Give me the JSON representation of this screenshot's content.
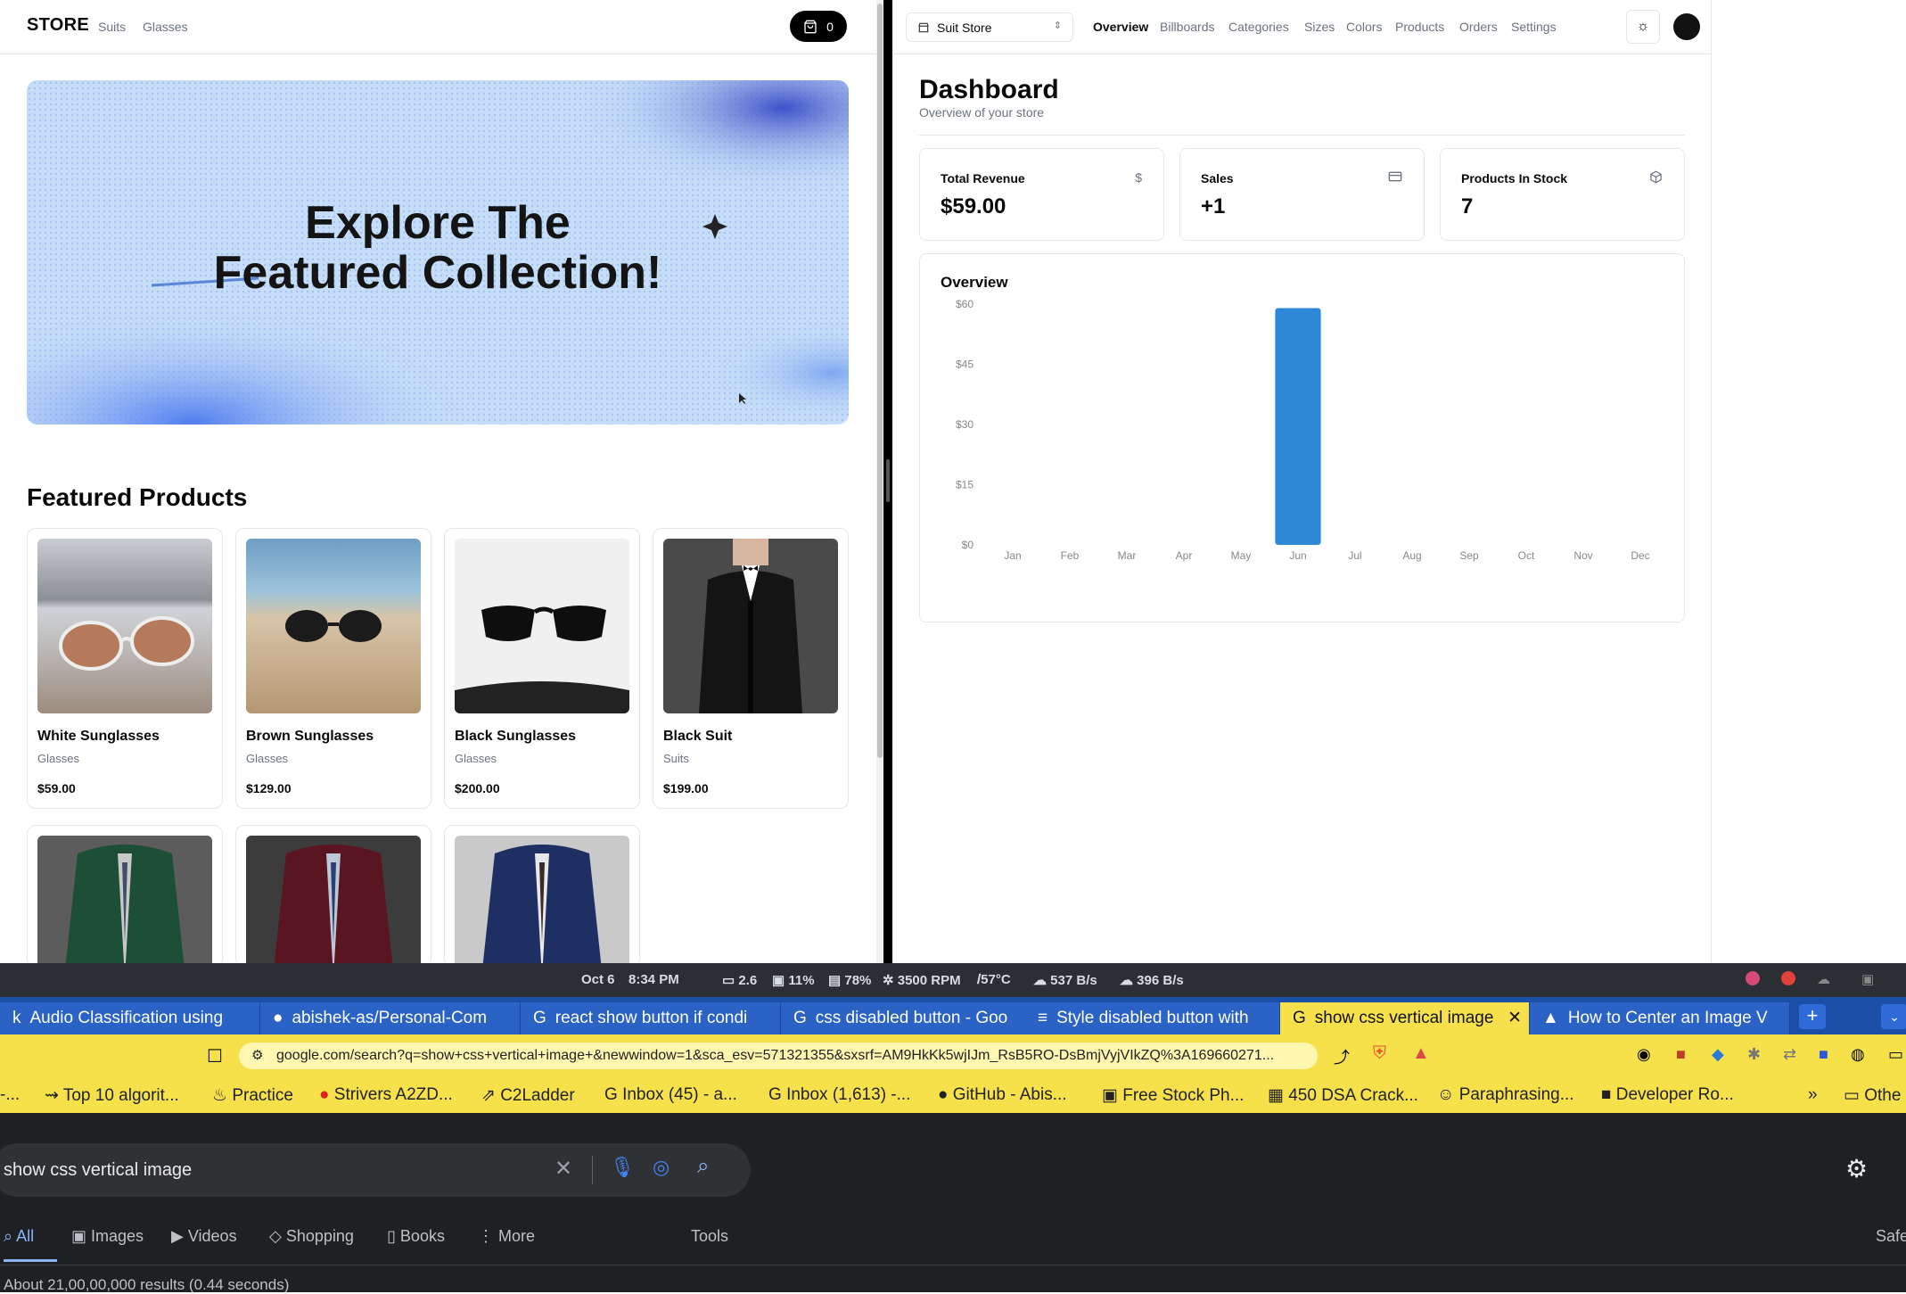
{
  "store": {
    "logo": "STORE",
    "nav": [
      "Suits",
      "Glasses"
    ],
    "cart_count": "0",
    "hero_line1": "Explore The",
    "hero_line2": "Featured Collection!",
    "featured_title": "Featured Products",
    "products": [
      {
        "name": "White Sunglasses",
        "category": "Glasses",
        "price": "$59.00"
      },
      {
        "name": "Brown Sunglasses",
        "category": "Glasses",
        "price": "$129.00"
      },
      {
        "name": "Black Sunglasses",
        "category": "Glasses",
        "price": "$200.00"
      },
      {
        "name": "Black Suit",
        "category": "Suits",
        "price": "$199.00"
      }
    ]
  },
  "dashboard": {
    "store_name": "Suit Store",
    "nav": [
      "Overview",
      "Billboards",
      "Categories",
      "Sizes",
      "Colors",
      "Products",
      "Orders",
      "Settings"
    ],
    "title": "Dashboard",
    "subtitle": "Overview of your store",
    "stats": [
      {
        "label": "Total Revenue",
        "value": "$59.00",
        "icon": "dollar-icon"
      },
      {
        "label": "Sales",
        "value": "+1",
        "icon": "credit-card-icon"
      },
      {
        "label": "Products In Stock",
        "value": "7",
        "icon": "package-icon"
      }
    ],
    "overview_title": "Overview"
  },
  "chart_data": {
    "type": "bar",
    "categories": [
      "Jan",
      "Feb",
      "Mar",
      "Apr",
      "May",
      "Jun",
      "Jul",
      "Aug",
      "Sep",
      "Oct",
      "Nov",
      "Dec"
    ],
    "values": [
      0,
      0,
      0,
      0,
      0,
      59,
      0,
      0,
      0,
      0,
      0,
      0
    ],
    "yticks": [
      "$0",
      "$15",
      "$30",
      "$45",
      "$60"
    ],
    "ylim": [
      0,
      60
    ],
    "color": "#2f89d8",
    "title": "Overview"
  },
  "system": {
    "date": "Oct 6",
    "time": "8:34 PM",
    "load": "2.6",
    "cpu": "11%",
    "mem": "78%",
    "fan": "3500 RPM",
    "temp": "57°C",
    "up": "537 B/s",
    "down": "396 B/s"
  },
  "browser": {
    "tabs": [
      "Audio Classification using",
      "abishek-as/Personal-Com",
      "react show button if condi",
      "css disabled button - Goo",
      "Style disabled button with",
      "show css vertical image",
      "How to Center an Image V"
    ],
    "url": "google.com/search?q=show+css+vertical+image+&newwindow=1&sca_esv=571321355&sxsrf=AM9HkKk5wjIJm_RsB5RO-DsBmjVyjVIkZQ%3A169660271...",
    "bookmarks": [
      "Top 10 algorit...",
      "Practice",
      "Strivers A2ZD...",
      "C2Ladder",
      "Inbox (45) - a...",
      "Inbox (1,613) -...",
      "GitHub - Abis...",
      "Free Stock Ph...",
      "450 DSA Crack...",
      "Paraphrasing...",
      "Developer Ro...",
      "Othe"
    ],
    "search_query": "show css vertical image",
    "search_tabs": [
      "All",
      "Images",
      "Videos",
      "Shopping",
      "Books",
      "More",
      "Tools"
    ],
    "results": "About 21,00,00,000 results (0.44 seconds)",
    "safe": "Safe"
  }
}
